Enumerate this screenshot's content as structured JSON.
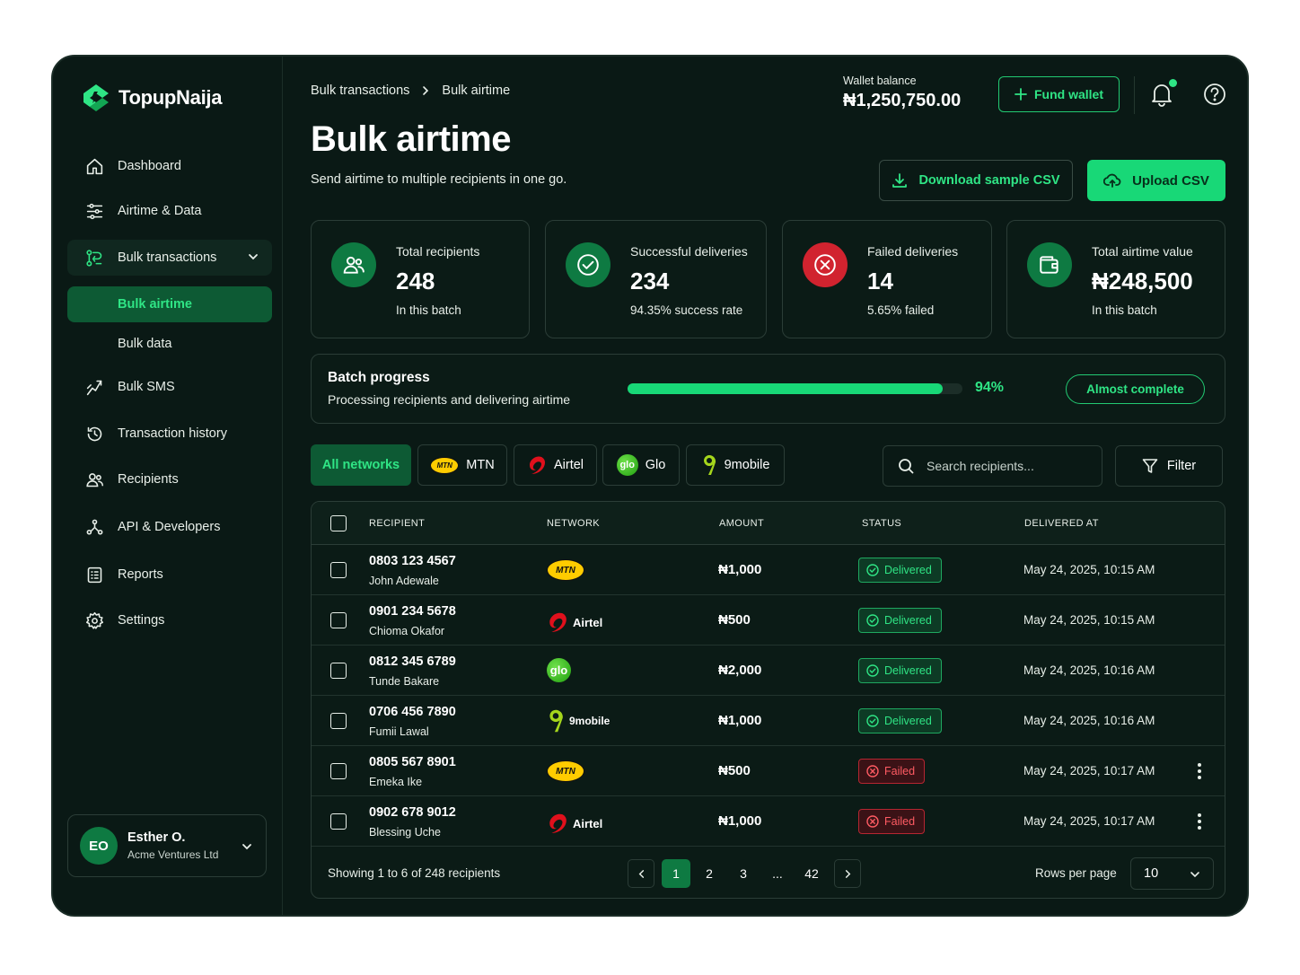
{
  "app": {
    "name": "TopupNaija"
  },
  "sidebar": {
    "items": [
      {
        "label": "Dashboard",
        "icon": "home-icon"
      },
      {
        "label": "Airtime & Data",
        "icon": "sliders-icon"
      },
      {
        "label": "Bulk transactions",
        "icon": "bulk-icon",
        "expanded": true
      },
      {
        "label": "Bulk airtime",
        "sub": true,
        "active": true
      },
      {
        "label": "Bulk data",
        "sub": true
      },
      {
        "label": "Bulk SMS",
        "icon": "lightning-icon"
      },
      {
        "label": "Transaction history",
        "icon": "history-icon"
      },
      {
        "label": "Recipients",
        "icon": "users-icon"
      },
      {
        "label": "API & Developers",
        "icon": "api-icon"
      },
      {
        "label": "Reports",
        "icon": "reports-icon"
      },
      {
        "label": "Settings",
        "icon": "gear-icon"
      }
    ],
    "user": {
      "initials": "EO",
      "name": "Esther O.",
      "org": "Acme Ventures Ltd"
    }
  },
  "header": {
    "breadcrumb": [
      "Bulk transactions",
      "Bulk airtime"
    ],
    "title": "Bulk airtime",
    "subtitle": "Send airtime to multiple recipients in one go.",
    "wallet_label": "Wallet balance",
    "wallet_value": "₦1,250,750.00",
    "fund_wallet": "Fund wallet",
    "download_csv": "Download sample CSV",
    "upload_csv": "Upload CSV"
  },
  "stats": [
    {
      "label": "Total recipients",
      "value": "248",
      "sub": "In this batch",
      "icon": "users-icon",
      "color": "#0e7a42"
    },
    {
      "label": "Successful deliveries",
      "value": "234",
      "sub": "94.35% success rate",
      "icon": "check-circle-icon",
      "color": "#0e7a42"
    },
    {
      "label": "Failed deliveries",
      "value": "14",
      "sub": "5.65% failed",
      "icon": "x-circle-icon",
      "color": "#d1232f"
    },
    {
      "label": "Total airtime value",
      "value": "₦248,500",
      "sub": "In this batch",
      "icon": "wallet-icon",
      "color": "#0e7a42"
    }
  ],
  "progress": {
    "title": "Batch progress",
    "subtitle": "Processing recipients and delivering airtime",
    "percent": 94,
    "percent_label": "94%",
    "badge": "Almost complete"
  },
  "filters": {
    "chips": [
      "All networks",
      "MTN",
      "Airtel",
      "Glo",
      "9mobile"
    ],
    "search_placeholder": "Search recipients...",
    "filter_label": "Filter"
  },
  "table": {
    "columns": [
      "RECIPIENT",
      "NETWORK",
      "AMOUNT",
      "STATUS",
      "DELIVERED AT"
    ],
    "rows": [
      {
        "phone": "0803 123 4567",
        "name": "John Adewale",
        "network": "MTN",
        "amount": "₦1,000",
        "status": "Delivered",
        "date": "May 24, 2025, 10:15 AM"
      },
      {
        "phone": "0901 234 5678",
        "name": "Chioma Okafor",
        "network": "Airtel",
        "amount": "₦500",
        "status": "Delivered",
        "date": "May 24, 2025, 10:15 AM"
      },
      {
        "phone": "0812 345 6789",
        "name": "Tunde Bakare",
        "network": "Glo",
        "amount": "₦2,000",
        "status": "Delivered",
        "date": "May 24, 2025, 10:16 AM"
      },
      {
        "phone": "0706 456 7890",
        "name": "Fumii Lawal",
        "network": "9mobile",
        "amount": "₦1,000",
        "status": "Delivered",
        "date": "May 24, 2025, 10:16 AM"
      },
      {
        "phone": "0805 567 8901",
        "name": "Emeka Ike",
        "network": "MTN",
        "amount": "₦500",
        "status": "Failed",
        "date": "May 24, 2025, 10:17 AM"
      },
      {
        "phone": "0902 678 9012",
        "name": "Blessing Uche",
        "network": "Airtel",
        "amount": "₦1,000",
        "status": "Failed",
        "date": "May 24, 2025, 10:17 AM"
      }
    ],
    "footer": "Showing 1 to 6 of 248 recipients",
    "pages": [
      "1",
      "2",
      "3",
      "...",
      "42"
    ],
    "current_page": "1",
    "rows_per_page_label": "Rows per page",
    "rows_per_page": "10"
  },
  "colors": {
    "accent": "#18d877",
    "background": "#0a1915",
    "danger": "#d1232f"
  }
}
